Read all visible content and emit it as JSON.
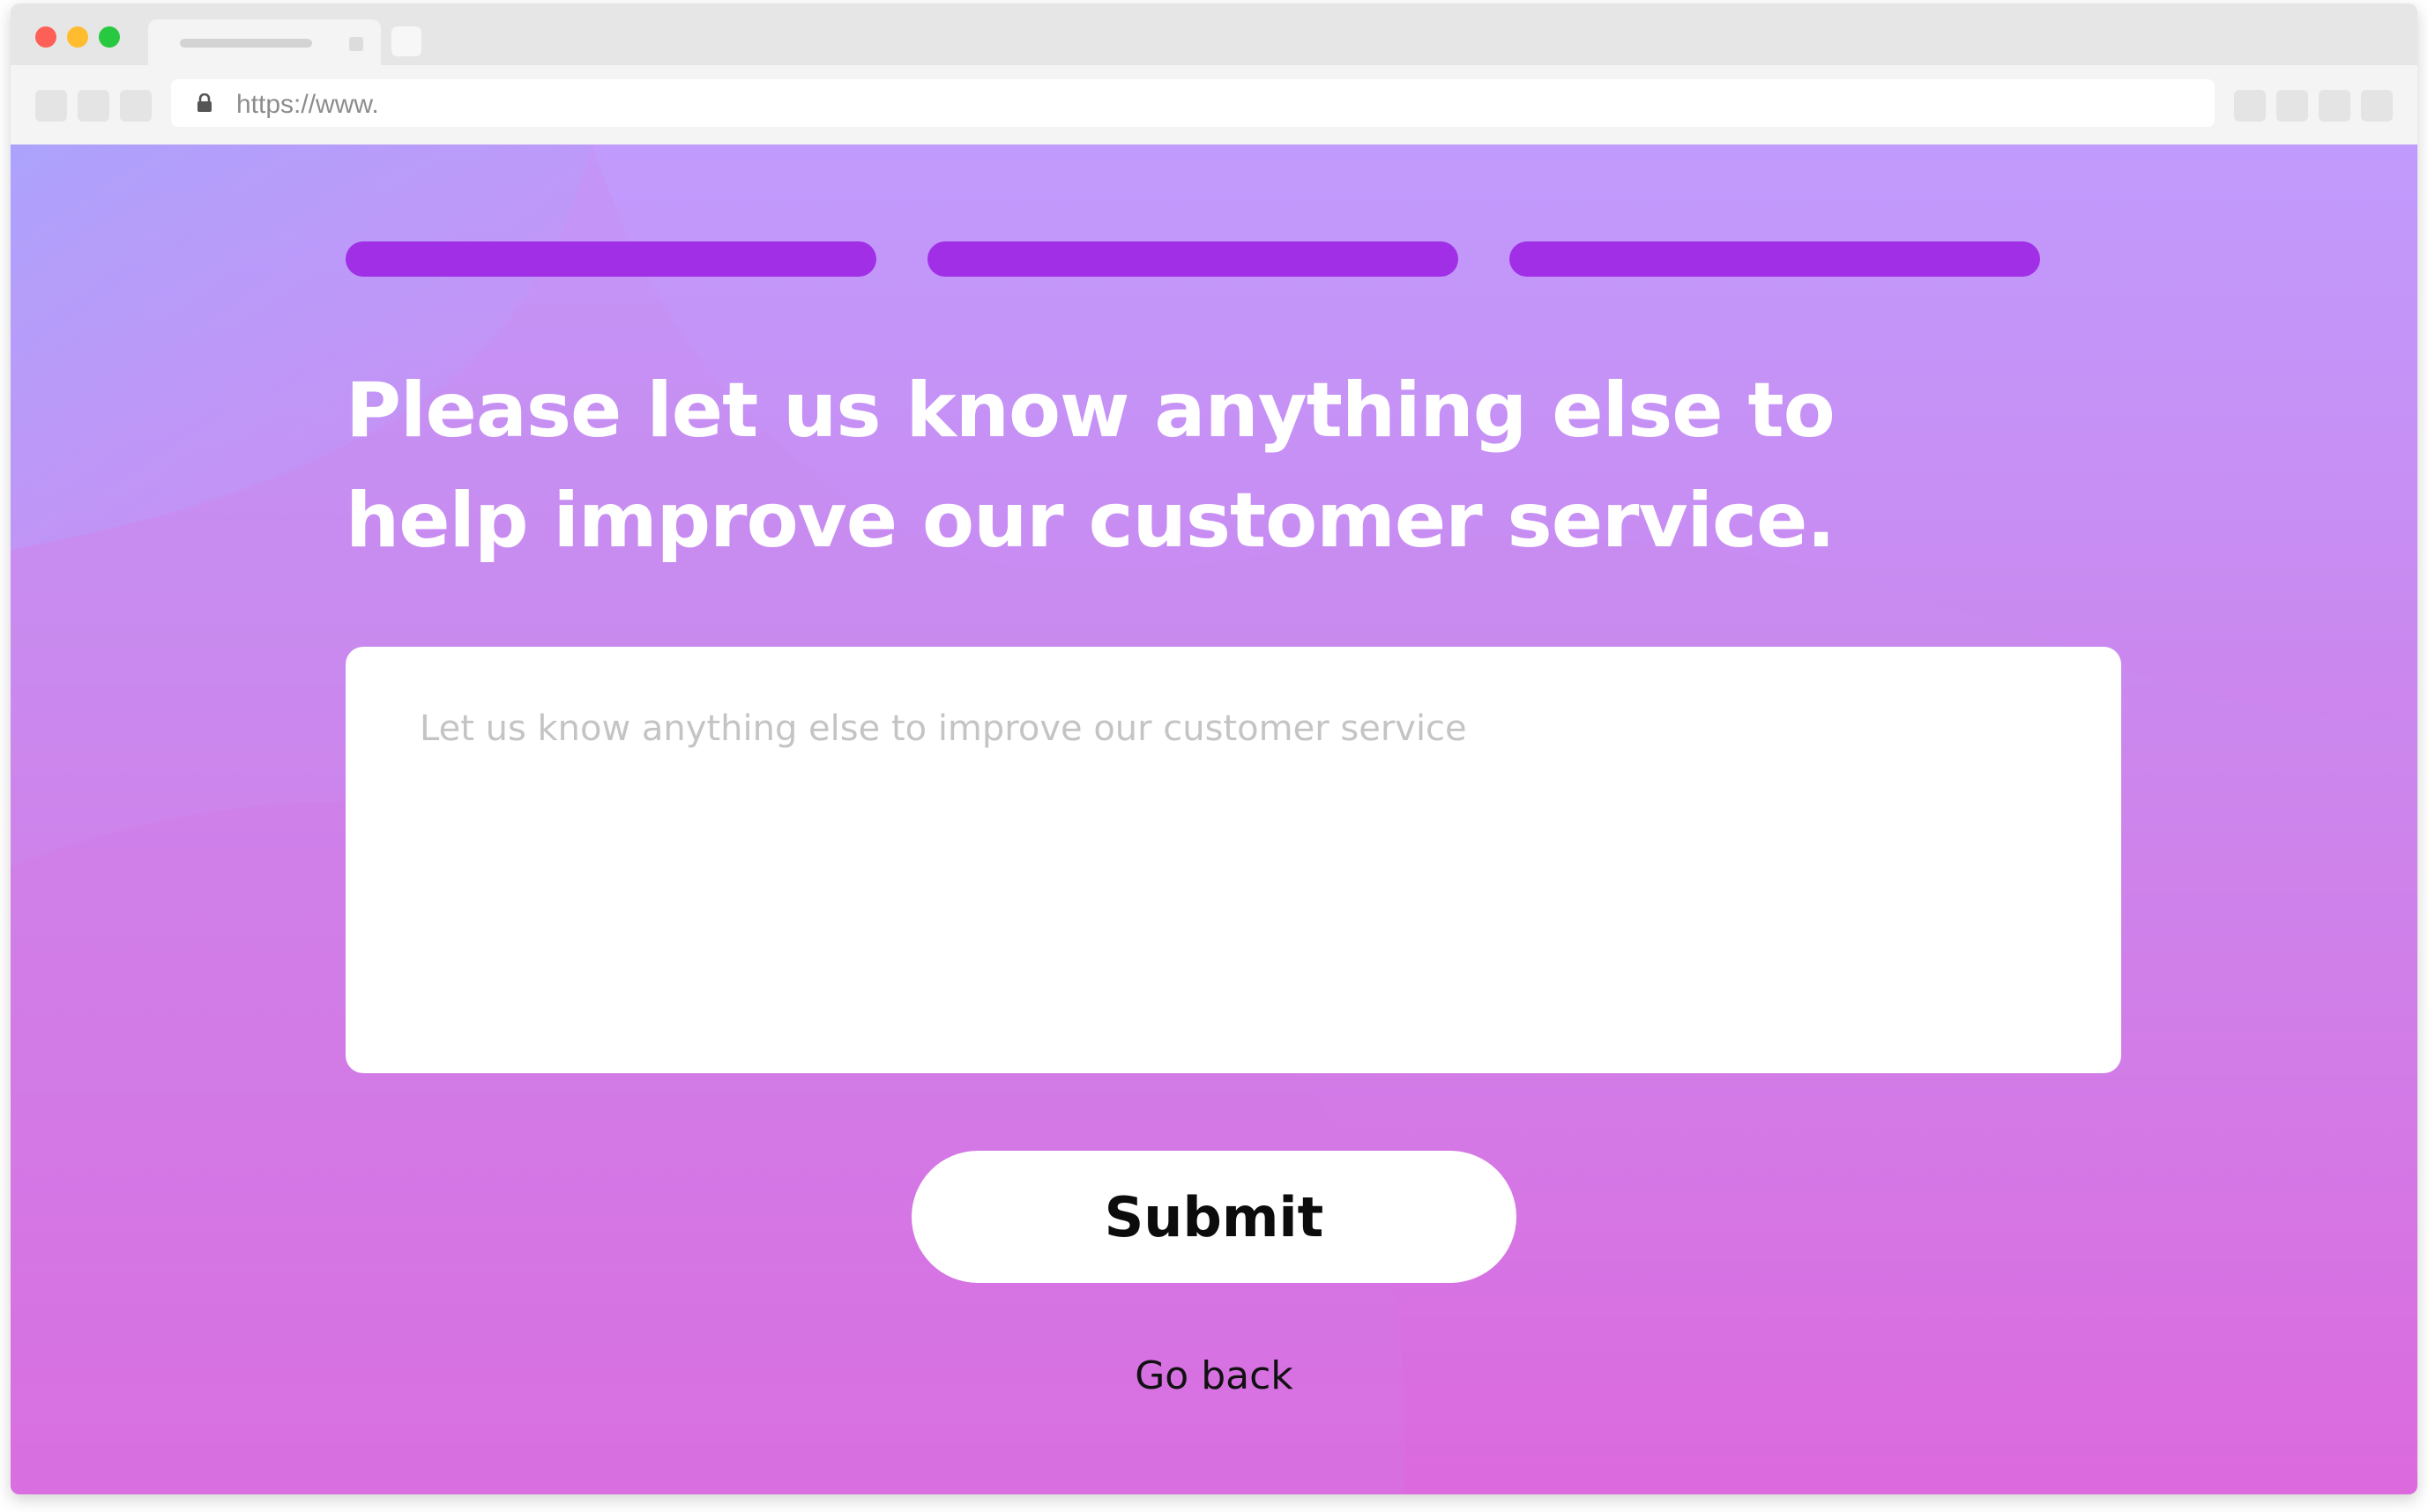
{
  "browser": {
    "url": "https://www."
  },
  "survey": {
    "progress_steps": [
      1,
      1,
      1
    ],
    "progress_color": "#a02fe6",
    "question": "Please let us know anything else to help improve our customer service.",
    "textarea_placeholder": "Let us know anything else to improve our customer service",
    "textarea_value": "",
    "submit_label": "Submit",
    "back_label": "Go back"
  },
  "colors": {
    "gradient_top": "#c19bfd",
    "gradient_bottom": "#e657d6",
    "text_light": "#ffffff"
  },
  "icons": {
    "lock": "lock-icon"
  }
}
